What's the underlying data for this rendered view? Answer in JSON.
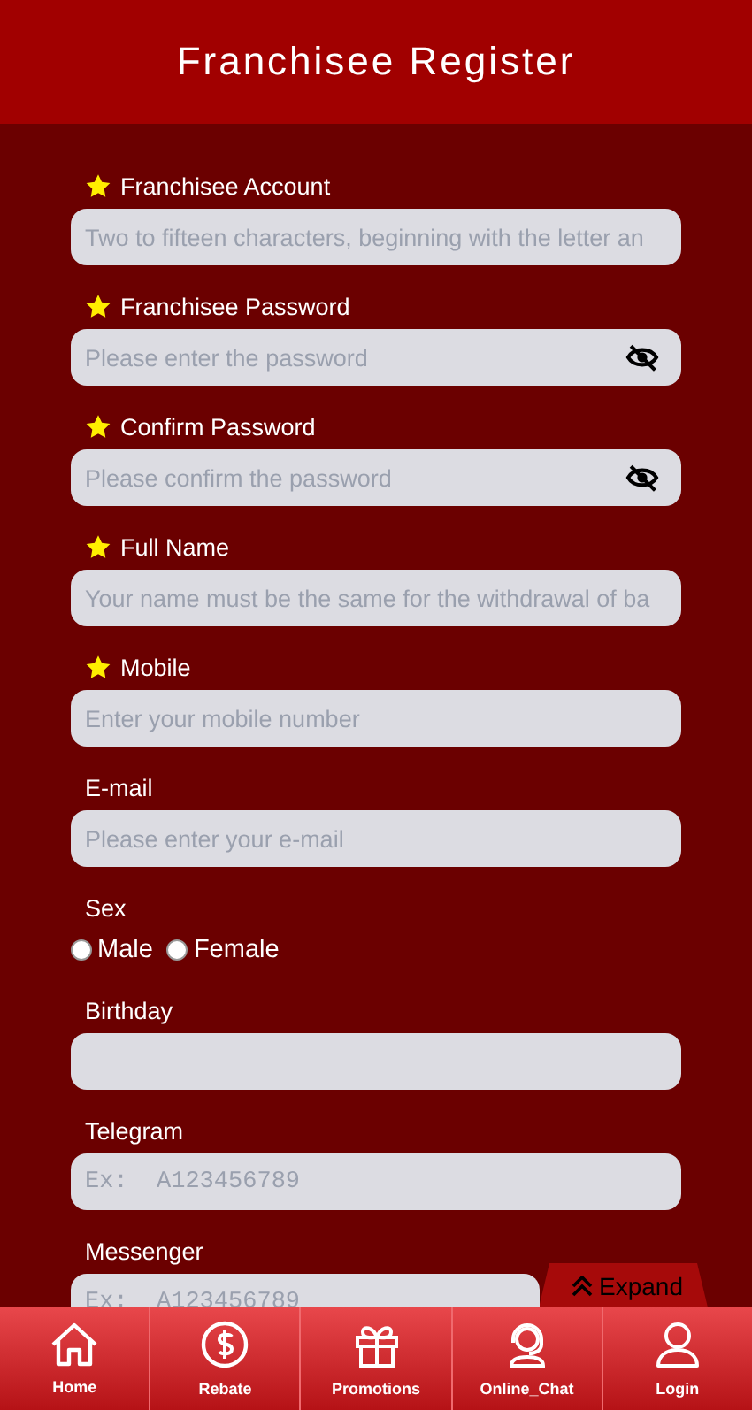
{
  "header": {
    "title": "Franchisee Register"
  },
  "fields": [
    {
      "kind": "text",
      "label": "Franchisee Account",
      "required": true,
      "placeholder": "Two to fifteen characters, beginning with the letter an"
    },
    {
      "kind": "password",
      "label": "Franchisee Password",
      "required": true,
      "placeholder": "Please enter the password"
    },
    {
      "kind": "password",
      "label": "Confirm Password",
      "required": true,
      "placeholder": "Please confirm the password"
    },
    {
      "kind": "text",
      "label": "Full Name",
      "required": true,
      "placeholder": "Your name must be the same for the withdrawal of ba"
    },
    {
      "kind": "text",
      "label": "Mobile",
      "required": true,
      "placeholder": "Enter your mobile number"
    },
    {
      "kind": "text",
      "label": "E-mail",
      "required": false,
      "placeholder": "Please enter your e-mail"
    },
    {
      "kind": "radio",
      "label": "Sex",
      "required": false,
      "options": [
        {
          "label": "Male",
          "selected": false
        },
        {
          "label": "Female",
          "selected": false
        }
      ]
    },
    {
      "kind": "text",
      "label": "Birthday",
      "required": false
    },
    {
      "kind": "mono",
      "label": "Telegram",
      "required": false,
      "placeholder": "Ex:  A123456789"
    },
    {
      "kind": "mono",
      "label": "Messenger",
      "required": false,
      "placeholder": "Ex:  A123456789"
    }
  ],
  "expand_button": {
    "label": "Expand"
  },
  "nav": [
    {
      "kind": "home",
      "label": "Home"
    },
    {
      "kind": "rebate",
      "label": "Rebate"
    },
    {
      "kind": "gift",
      "label": "Promotions"
    },
    {
      "kind": "chat",
      "label": "Online_Chat"
    },
    {
      "kind": "user",
      "label": "Login"
    }
  ]
}
